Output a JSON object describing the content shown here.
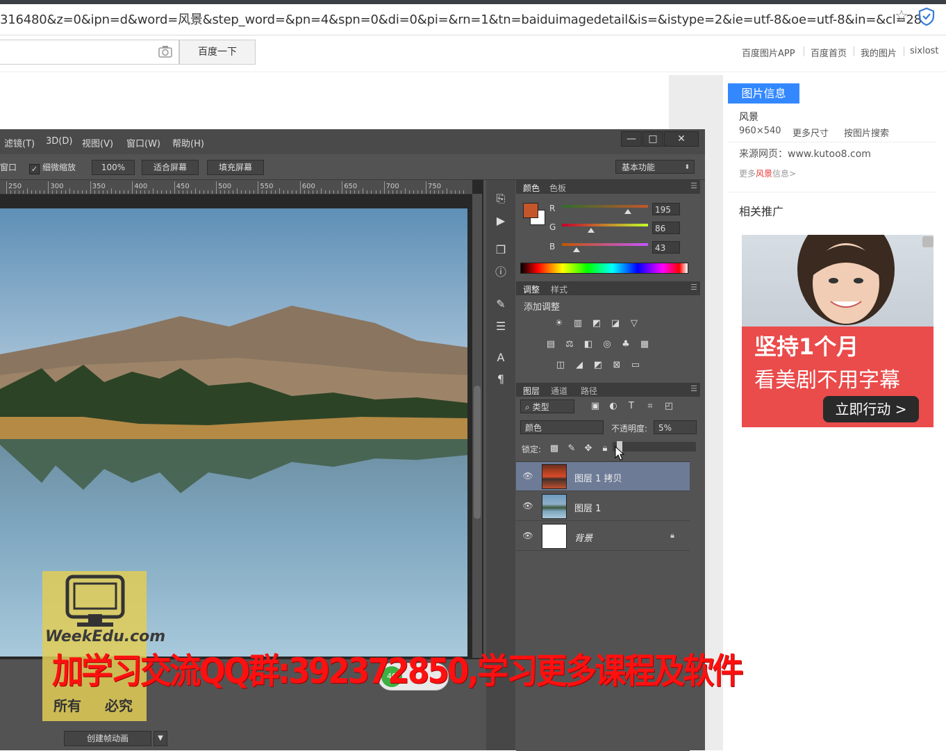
{
  "browser": {
    "url": "316480&z=0&ipn=d&word=风景&step_word=&pn=4&spn=0&di=0&pi=&rn=1&tn=baiduimagedetail&is=&istype=2&ie=utf-8&oe=utf-8&in=&cl=28",
    "star_icon": "star-icon",
    "shield_icon": "shield-icon"
  },
  "baidu": {
    "search_button": "百度一下",
    "links": [
      "百度图片APP",
      "百度首页",
      "我的图片",
      "sixlost"
    ]
  },
  "info_panel": {
    "tab": "图片信息",
    "title": "风景",
    "size": "960×540",
    "more_sizes": "更多尺寸",
    "search_by_image": "按图片搜索",
    "source": "来源网页：www.kutoo8.com",
    "more_info_prefix": "更多",
    "more_info_keyword": "风景",
    "more_info_suffix": "信息>",
    "promo_heading": "相关推广",
    "ad": {
      "line1": "坚持1个月",
      "line2": "看美剧不用字幕",
      "button": "立即行动 >"
    }
  },
  "photoshop": {
    "menu": [
      "滤镜(T)",
      "3D(D)",
      "视图(V)",
      "窗口(W)",
      "帮助(H)"
    ],
    "window_buttons": [
      "—",
      "□",
      "✕"
    ],
    "options": {
      "window_label": "窗口",
      "scrubby_zoom": "细微缩放",
      "zoom_100": "100%",
      "fit_screen": "适合屏幕",
      "fill_screen": "填充屏幕",
      "workspace": "基本功能"
    },
    "ruler_labels": [
      "250",
      "300",
      "350",
      "400",
      "450",
      "500",
      "550",
      "600",
      "650",
      "700",
      "750"
    ],
    "color_panel": {
      "tabs": [
        "颜色",
        "色板"
      ],
      "r_label": "R",
      "g_label": "G",
      "b_label": "B",
      "r": "195",
      "g": "86",
      "b": "43",
      "fg_color": "#c3562b"
    },
    "adjust_panel": {
      "tabs": [
        "调整",
        "样式"
      ],
      "title": "添加调整"
    },
    "layers_panel": {
      "tabs": [
        "图层",
        "通道",
        "路径"
      ],
      "filter_kind": "类型",
      "blend_mode": "颜色",
      "opacity_label": "不透明度:",
      "opacity": "5%",
      "lock_label": "锁定:",
      "layers": [
        {
          "name": "图层 1 拷贝",
          "selected": true
        },
        {
          "name": "图层 1",
          "selected": false
        },
        {
          "name": "背景",
          "selected": false,
          "locked": true
        }
      ]
    },
    "timeline": {
      "create_animation": "创建帧动画"
    }
  },
  "watermark": {
    "logo": "WeekEdu.com",
    "left_text": "所有",
    "right_text": "必究",
    "banner": "加学习交流QQ群:392372850,学习更多课程及软件",
    "percent": "40"
  }
}
